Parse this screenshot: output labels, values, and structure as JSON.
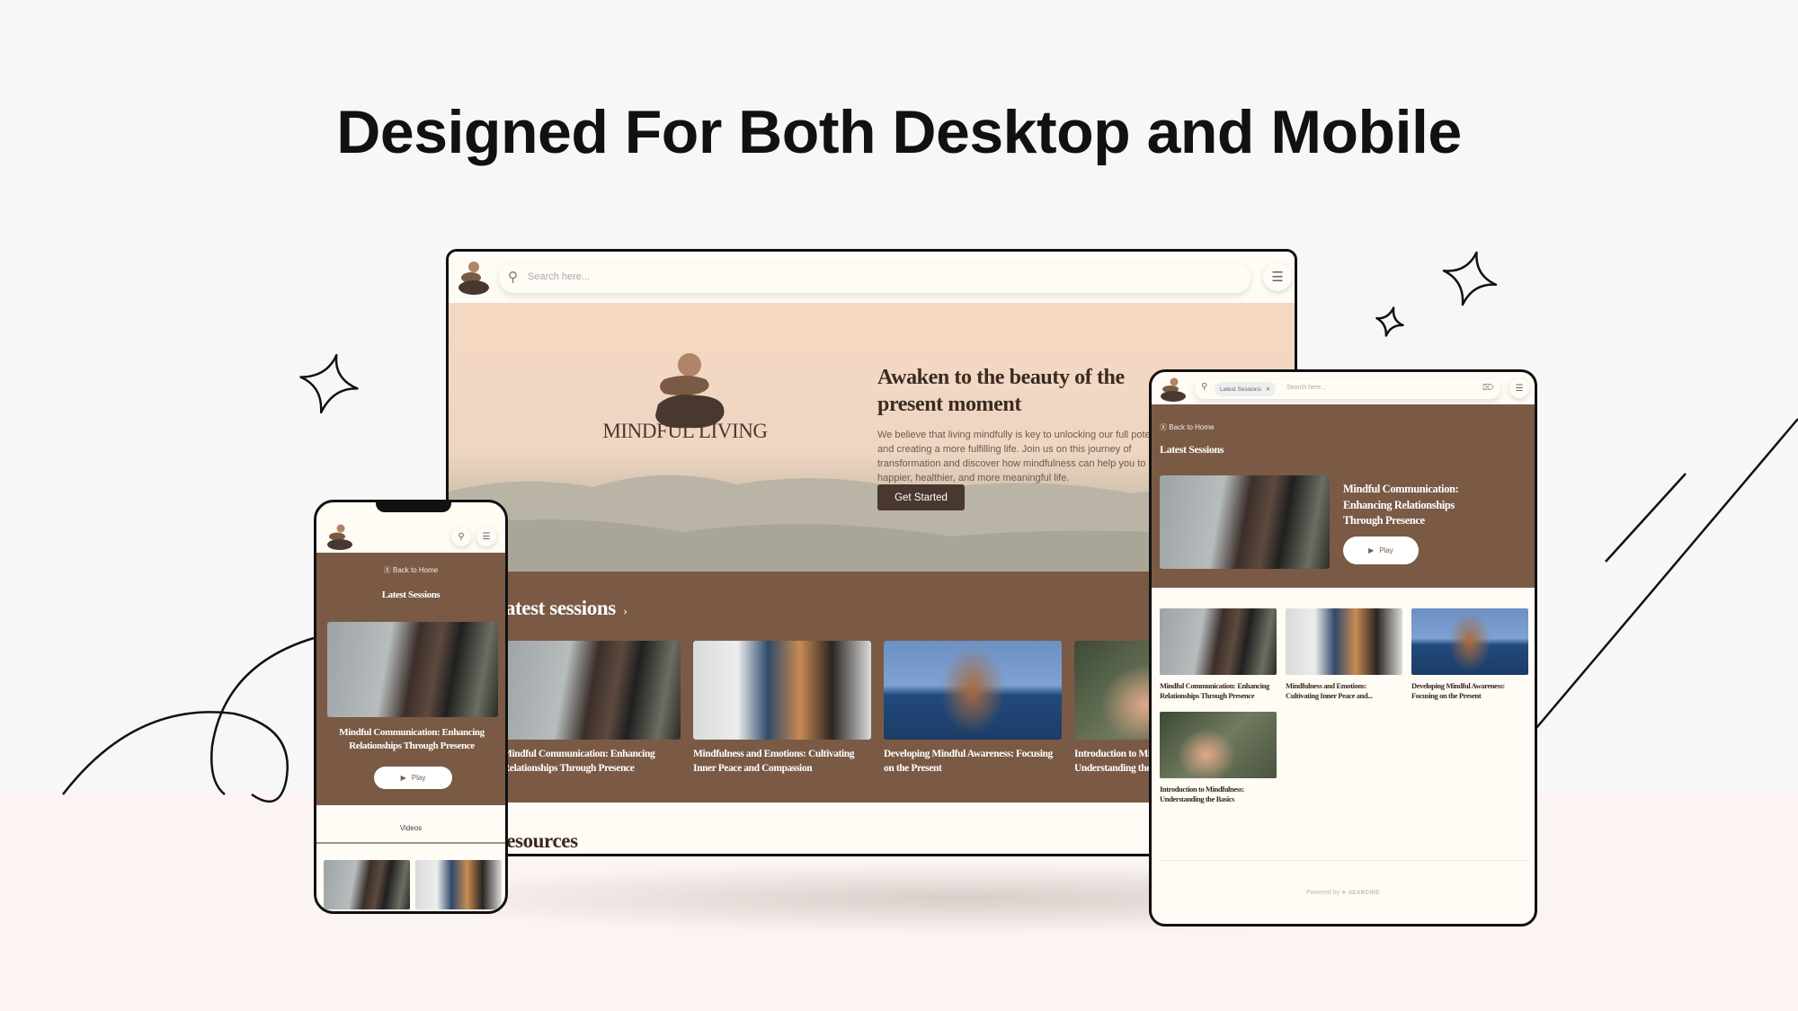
{
  "headline": "Designed For Both Desktop and Mobile",
  "colors": {
    "brand_brown": "#7a5a45",
    "dark_brown": "#483830",
    "cream": "#fffbf5",
    "peach": "#f5dcc8"
  },
  "desktop": {
    "search_placeholder": "Search here...",
    "icons": [
      "logo-stones-icon",
      "search-icon",
      "menu-icon"
    ],
    "hero": {
      "brand": "MINDFUL LIVING",
      "title": "Awaken to the beauty of the present moment",
      "text": "We believe that living mindfully is key to unlocking our full potential and creating a more fulfilling life. Join us on this journey of transformation and discover how mindfulness can help you to live a happier, healthier, and more meaningful life.",
      "button": "Get Started"
    },
    "sessions_heading": "Latest sessions",
    "sessions": [
      "Mindful Communication: Enhancing Relationships Through Presence",
      "Mindfulness and Emotions: Cultivating Inner Peace and Compassion",
      "Developing Mindful Awareness: Focusing on the Present",
      "Introduction to Mindfulness: Understanding the Basics"
    ],
    "resources_heading": "Resources"
  },
  "phone": {
    "back": "Back to Home",
    "heading": "Latest Sessions",
    "featured_title": "Mindful Communication: Enhancing Relationships Through Presence",
    "play": "Play",
    "tab": "Videos"
  },
  "tablet": {
    "chip": "Latest Sessions",
    "search_placeholder": "Search here...",
    "back": "Back to Home",
    "heading": "Latest Sessions",
    "featured_title": "Mindful Communication: Enhancing Relationships Through Presence",
    "play": "Play",
    "grid": [
      "Mindful Communication: Enhancing Relationships Through Presence",
      "Mindfulness and Emotions: Cultivating Inner Peace and...",
      "Developing Mindful Awareness: Focusing on the Present",
      "Introduction to Mindfulness: Understanding the Basics"
    ],
    "powered_by": "Powered by",
    "powered_brand": "SEARCHIE"
  }
}
